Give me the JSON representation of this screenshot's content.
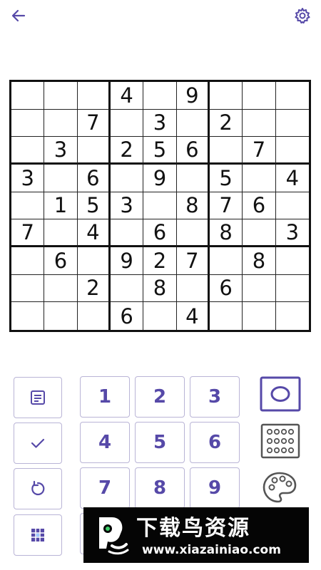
{
  "icons": {
    "back": "arrow-left-icon",
    "settings": "gear-icon",
    "notes": "notes-icon",
    "check": "check-icon",
    "reset": "refresh-icon",
    "grid": "grid-icon",
    "circle_mode": "circle-mode-icon",
    "dots_mode": "dots-grid-icon",
    "palette": "palette-icon"
  },
  "colors": {
    "accent": "#5649a8",
    "button_border": "#b9b4d6",
    "grid_line": "#111111"
  },
  "board": [
    [
      "",
      "",
      "",
      "4",
      "",
      "9",
      "",
      "",
      ""
    ],
    [
      "",
      "",
      "7",
      "",
      "3",
      "",
      "2",
      "",
      ""
    ],
    [
      "",
      "3",
      "",
      "2",
      "5",
      "6",
      "",
      "7",
      ""
    ],
    [
      "3",
      "",
      "6",
      "",
      "9",
      "",
      "5",
      "",
      "4"
    ],
    [
      "",
      "1",
      "5",
      "3",
      "",
      "8",
      "7",
      "6",
      ""
    ],
    [
      "7",
      "",
      "4",
      "",
      "6",
      "",
      "8",
      "",
      "3"
    ],
    [
      "",
      "6",
      "",
      "9",
      "2",
      "7",
      "",
      "8",
      ""
    ],
    [
      "",
      "",
      "2",
      "",
      "8",
      "",
      "6",
      "",
      ""
    ],
    [
      "",
      "",
      "",
      "6",
      "",
      "4",
      "",
      "",
      ""
    ]
  ],
  "keypad": {
    "n1": "1",
    "n2": "2",
    "n3": "3",
    "n4": "4",
    "n5": "5",
    "n6": "6",
    "n7": "7",
    "n8": "8",
    "n9": "9"
  },
  "watermark": {
    "title": "下载鸟资源",
    "url": "www.xiazainiao.com"
  }
}
